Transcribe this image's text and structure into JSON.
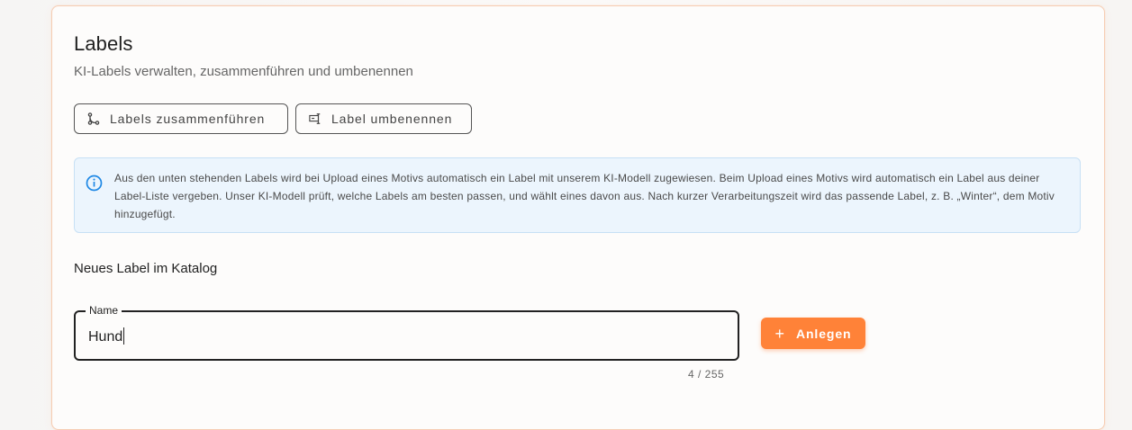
{
  "header": {
    "title": "Labels",
    "subtitle": "KI-Labels verwalten, zusammenführen und umbenennen"
  },
  "actions": {
    "merge_label": "Labels zusammenführen",
    "merge_icon": "merge-icon",
    "rename_label": "Label umbenennen",
    "rename_icon": "rename-icon"
  },
  "info": {
    "icon": "info-icon",
    "text": "Aus den unten stehenden Labels wird bei Upload eines Motivs automatisch ein Label mit unserem KI-Modell zugewiesen. Beim Upload eines Motivs wird automatisch ein Label aus deiner Label-Liste vergeben. Unser KI-Modell prüft, welche Labels am besten passen, und wählt eines davon aus. Nach kurzer Verarbeitungszeit wird das passende Label, z. B. „Winter“, dem Motiv hinzugefügt."
  },
  "new_label": {
    "section_title": "Neues Label im Katalog",
    "field_label": "Name",
    "value": "Hund",
    "counter": "4 / 255",
    "submit_label": "Anlegen"
  },
  "colors": {
    "accent": "#ff8238",
    "info_bg": "#ecf5fd",
    "info_icon": "#1e88e5"
  }
}
